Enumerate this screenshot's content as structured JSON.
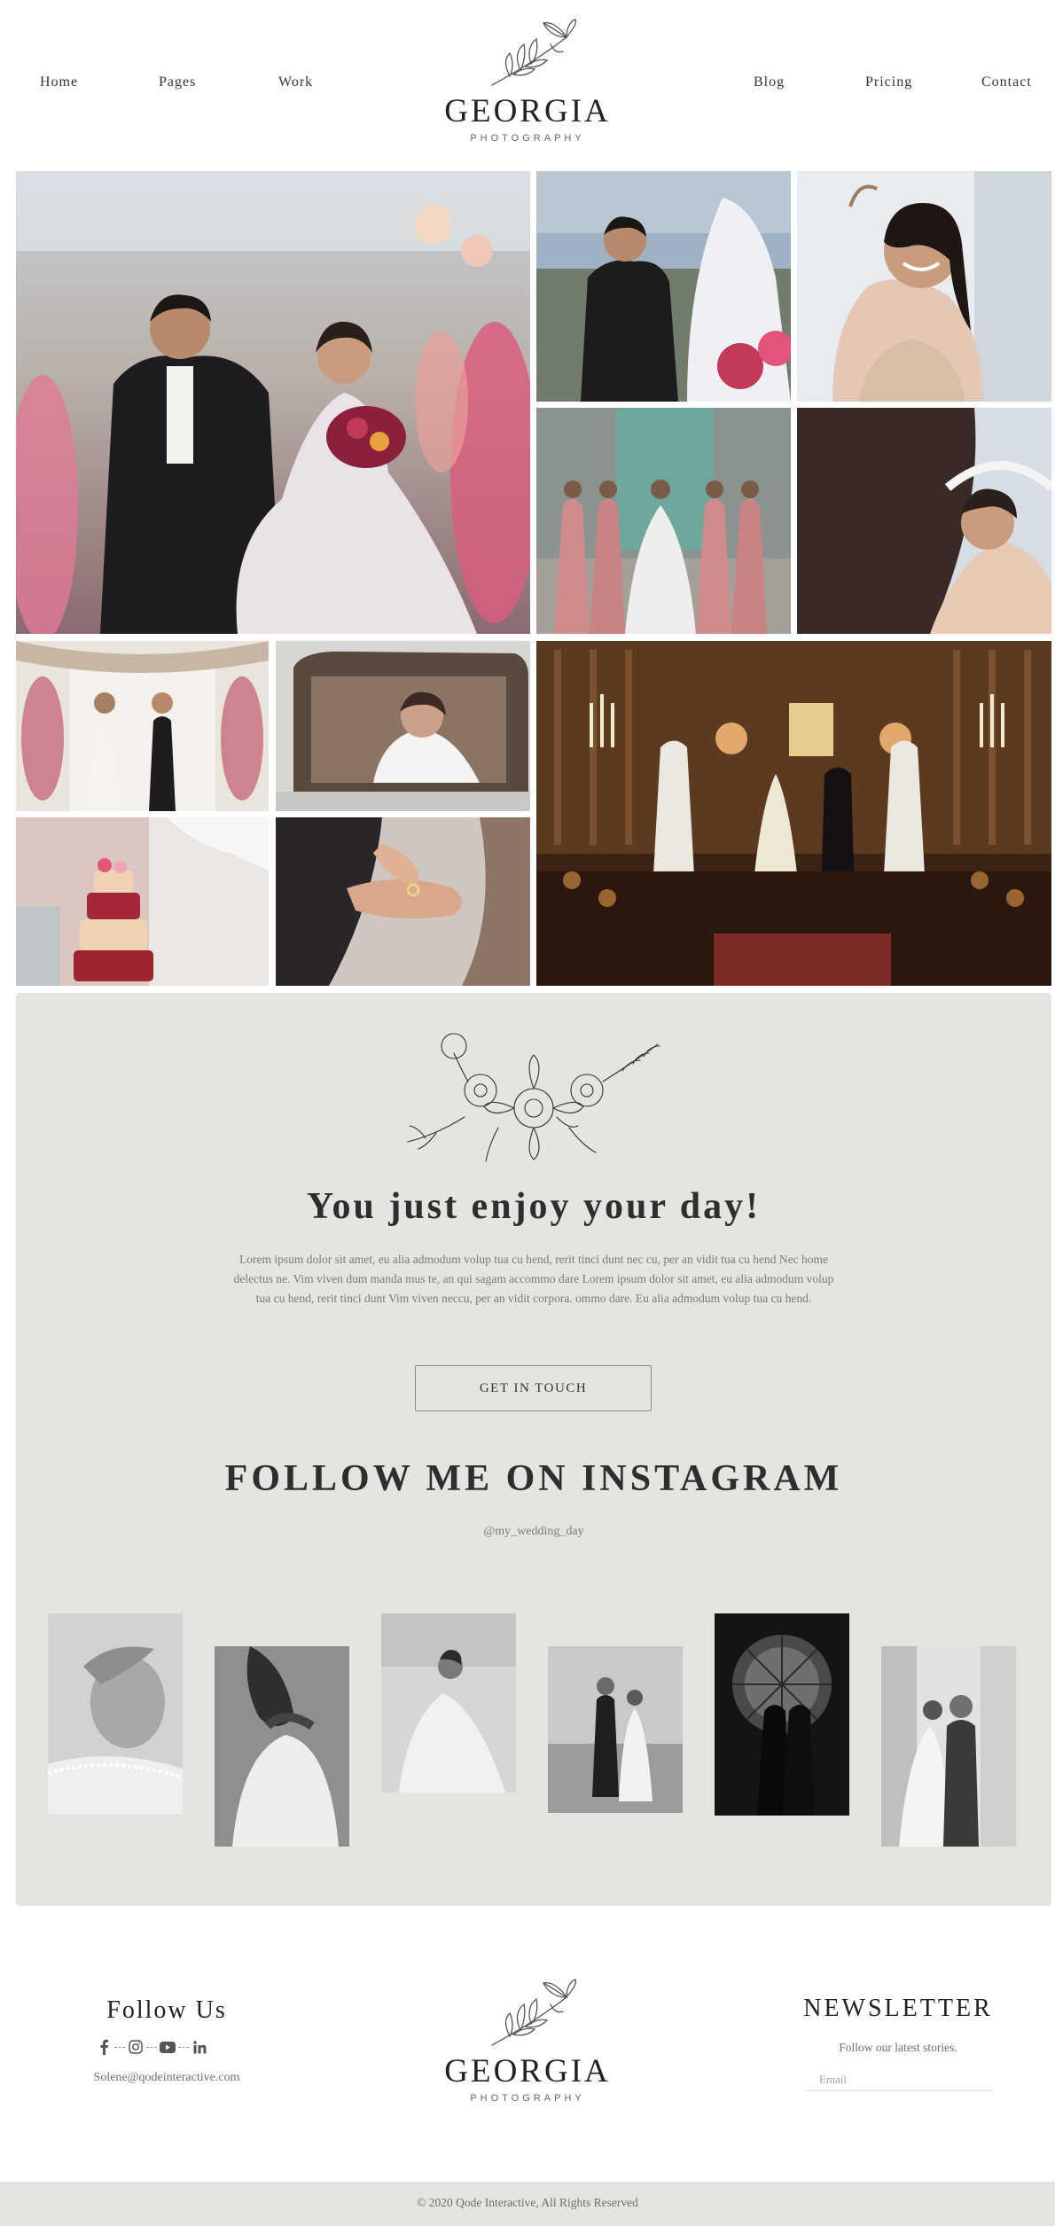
{
  "nav": {
    "left": [
      "Home",
      "Pages",
      "Work"
    ],
    "right": [
      "Blog",
      "Pricing",
      "Contact"
    ]
  },
  "brand": {
    "name": "GEORGIA",
    "sub": "PHOTOGRAPHY"
  },
  "feature": {
    "tagline": "You just enjoy your day!",
    "intro": "Lorem ipsum dolor sit amet, eu alia admodum volup tua cu hend, rerit tinci dunt nec cu, per an vidit tua cu hend Nec home delectus ne. Vim viven dum manda mus te, an qui sagam accommo dare Lorem ipsum dolor sit amet, eu alia admodum volup tua cu hend, rerit tinci dunt Vim viven neccu, per an vidit corpora. ommo dare. Eu alia admodum volup tua cu hend.",
    "cta_label": "GET IN TOUCH"
  },
  "instagram": {
    "title": "FOLLOW ME ON INSTAGRAM",
    "handle": "@my_wedding_day"
  },
  "footer": {
    "follow_title": "Follow Us",
    "socials": [
      "facebook-icon",
      "instagram-icon",
      "youtube-icon",
      "linkedin-icon"
    ],
    "email": "Solene@qodeinteractive.com",
    "newsletter_title": "NEWSLETTER",
    "newsletter_sub": "Follow our latest stories.",
    "email_placeholder": "Email",
    "copyright": "© 2020 Qode Interactive, All Rights Reserved"
  },
  "colors": {
    "panel_bg": "#e4e5e1",
    "text_dark": "#2b2b2b",
    "text_muted": "#7a7a7a"
  }
}
